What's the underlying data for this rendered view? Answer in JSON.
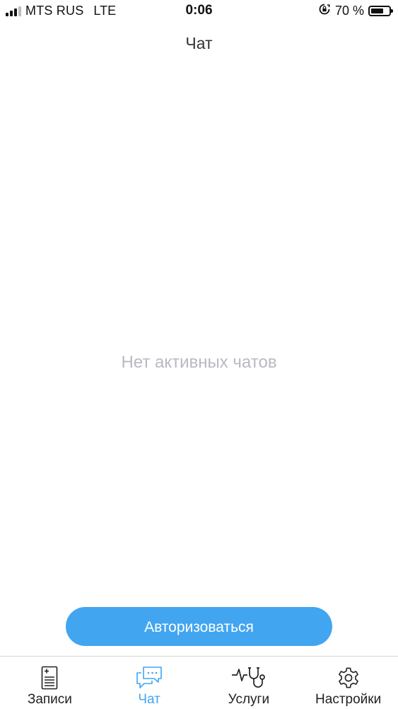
{
  "status_bar": {
    "carrier": "MTS RUS",
    "network": "LTE",
    "time": "0:06",
    "battery_text": "70 %",
    "battery_level": 0.7
  },
  "header": {
    "title": "Чат"
  },
  "main": {
    "empty_text": "Нет активных чатов",
    "auth_button_label": "Авторизоваться"
  },
  "tabs": [
    {
      "label": "Записи",
      "icon": "records-icon",
      "active": false
    },
    {
      "label": "Чат",
      "icon": "chat-icon",
      "active": true
    },
    {
      "label": "Услуги",
      "icon": "stethoscope-icon",
      "active": false
    },
    {
      "label": "Настройки",
      "icon": "gear-icon",
      "active": false
    }
  ],
  "colors": {
    "accent": "#42a5f0",
    "placeholder_text": "#b9b9c4"
  }
}
